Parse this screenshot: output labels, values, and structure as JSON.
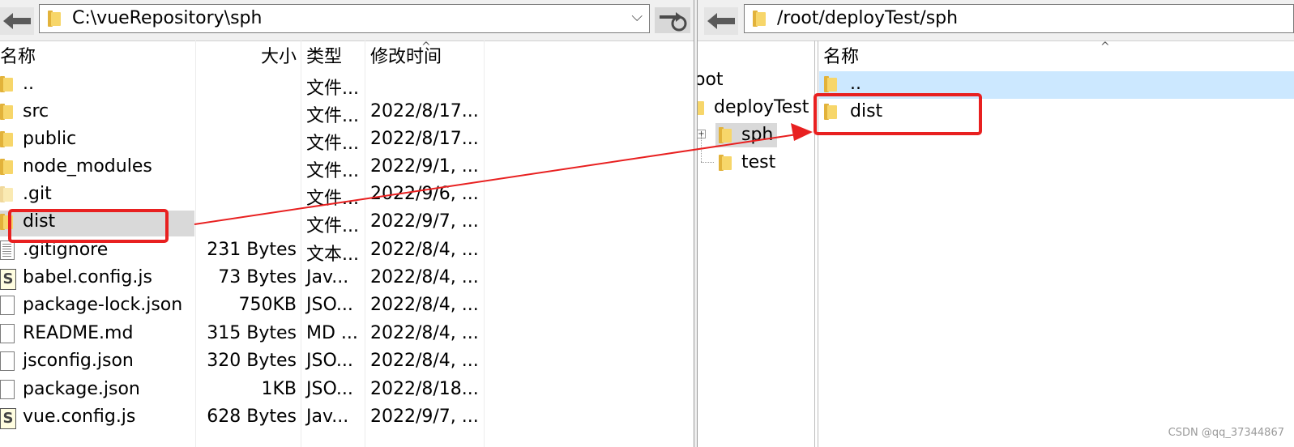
{
  "left": {
    "path": "C:\\vueRepository\\sph",
    "columns": {
      "name": "名称",
      "size": "大小",
      "type": "类型",
      "modified": "修改时间"
    },
    "rows": [
      {
        "name": "..",
        "size": "",
        "type": "文件...",
        "modified": "",
        "icon": "folder-icon"
      },
      {
        "name": "src",
        "size": "",
        "type": "文件...",
        "modified": "2022/8/17...",
        "icon": "folder-icon"
      },
      {
        "name": "public",
        "size": "",
        "type": "文件...",
        "modified": "2022/8/17...",
        "icon": "folder-icon"
      },
      {
        "name": "node_modules",
        "size": "",
        "type": "文件...",
        "modified": "2022/9/1, ...",
        "icon": "folder-icon"
      },
      {
        "name": ".git",
        "size": "",
        "type": "文件...",
        "modified": "2022/9/6, ...",
        "icon": "folder-icon"
      },
      {
        "name": "dist",
        "size": "",
        "type": "文件...",
        "modified": "2022/9/7, ...",
        "icon": "folder-icon"
      },
      {
        "name": ".gitignore",
        "size": "231 Bytes",
        "type": "文本...",
        "modified": "2022/8/4, ...",
        "icon": "text-file-icon"
      },
      {
        "name": "babel.config.js",
        "size": "73 Bytes",
        "type": "Jav...",
        "modified": "2022/8/4, ...",
        "icon": "js-file-icon"
      },
      {
        "name": "package-lock.json",
        "size": "750KB",
        "type": "JSO...",
        "modified": "2022/8/4, ...",
        "icon": "file-icon"
      },
      {
        "name": "README.md",
        "size": "315 Bytes",
        "type": "MD ...",
        "modified": "2022/8/4, ...",
        "icon": "file-icon"
      },
      {
        "name": "jsconfig.json",
        "size": "320 Bytes",
        "type": "JSO...",
        "modified": "2022/8/4, ...",
        "icon": "file-icon"
      },
      {
        "name": "package.json",
        "size": "1KB",
        "type": "JSO...",
        "modified": "2022/8/18...",
        "icon": "file-icon"
      },
      {
        "name": "vue.config.js",
        "size": "628 Bytes",
        "type": "Jav...",
        "modified": "2022/9/7, ...",
        "icon": "js-file-icon"
      }
    ]
  },
  "right": {
    "path": "/root/deployTest/sph",
    "columns": {
      "name": "名称"
    },
    "tree": [
      "oot",
      "deployTest",
      "sph",
      "test"
    ],
    "rows": [
      {
        "name": ".."
      },
      {
        "name": "dist"
      }
    ]
  },
  "annotations": {
    "highlight_color": "#e82020"
  },
  "watermark": "CSDN @qq_37344867"
}
